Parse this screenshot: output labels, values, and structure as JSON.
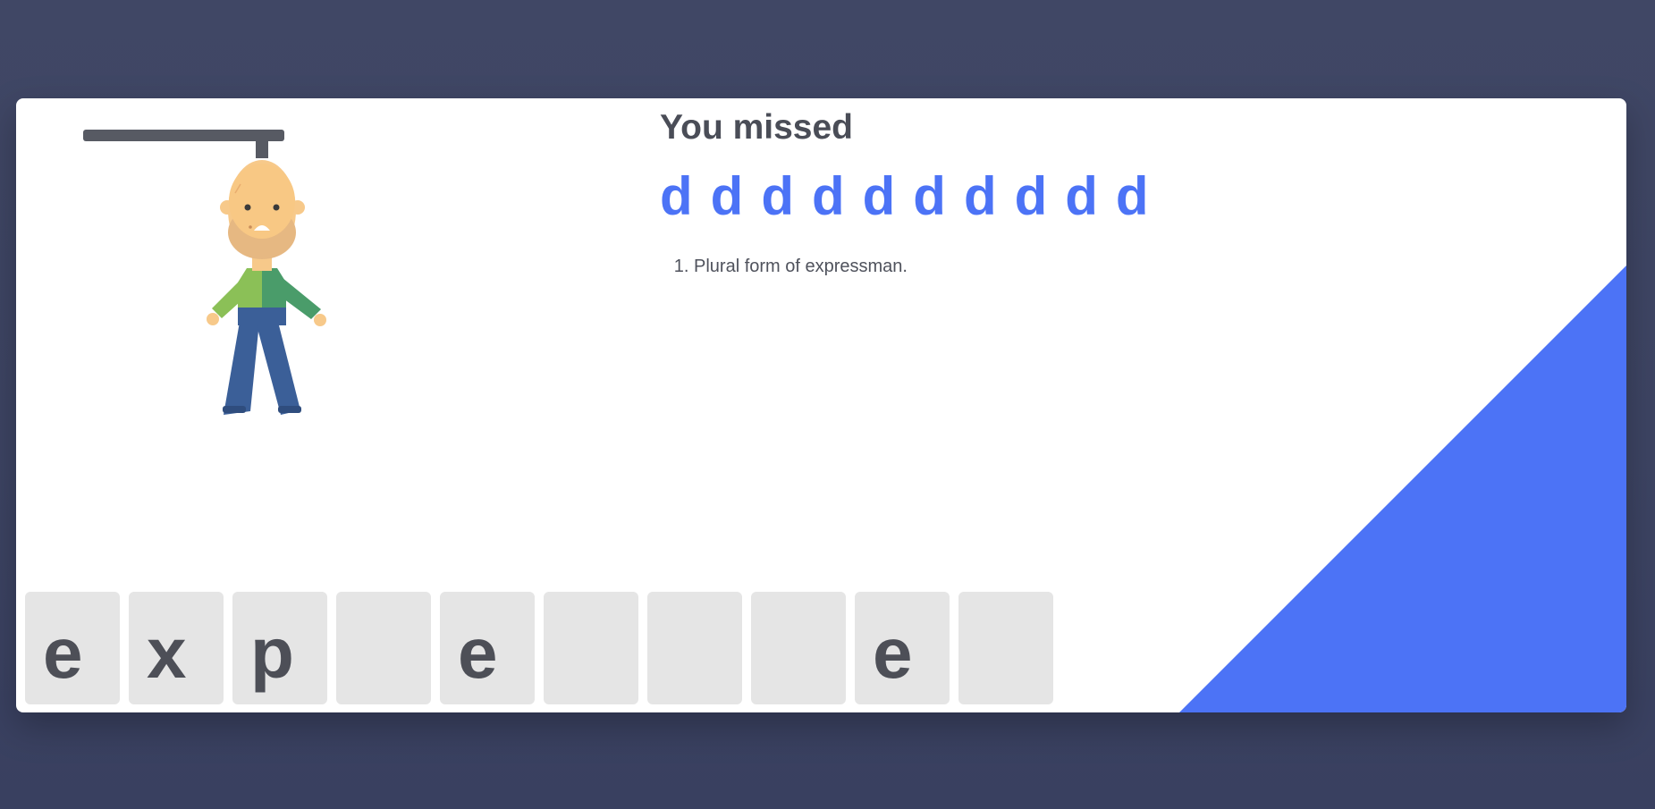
{
  "game": {
    "title": "You missed",
    "missed_letters": [
      "d",
      "d",
      "d",
      "d",
      "d",
      "d",
      "d",
      "d",
      "d",
      "d"
    ],
    "hints": [
      "Plural form of expressman."
    ],
    "word_slots": [
      "e",
      "x",
      "p",
      "",
      "e",
      "",
      "",
      "",
      "e",
      ""
    ],
    "wrong_guess_stage": 6
  },
  "colors": {
    "background": "#3d4463",
    "card": "#ffffff",
    "accent": "#4c73f6",
    "text": "#4a4d57",
    "slot": "#e5e5e5",
    "gallows": "#575a63"
  },
  "icons": {
    "figure": "hangman-figure-icon"
  }
}
